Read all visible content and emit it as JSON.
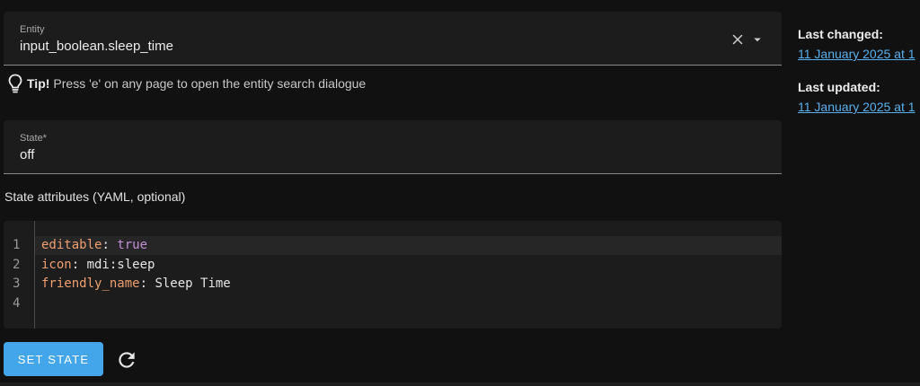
{
  "entity_field": {
    "label": "Entity",
    "value": "input_boolean.sleep_time"
  },
  "tip": {
    "title": "Tip!",
    "text": "Press 'e' on any page to open the entity search dialogue"
  },
  "state_field": {
    "label": "State*",
    "value": "off"
  },
  "attributes": {
    "label": "State attributes (YAML, optional)",
    "line_numbers": [
      "1",
      "2",
      "3",
      "4"
    ],
    "lines": [
      {
        "key": "editable",
        "value": "true"
      },
      {
        "key": "icon",
        "value": "mdi:sleep"
      },
      {
        "key": "friendly_name",
        "value": "Sleep Time"
      }
    ]
  },
  "actions": {
    "set_state_label": "SET STATE"
  },
  "sidebar": {
    "last_changed_label": "Last changed:",
    "last_changed_value": "11 January 2025 at 1",
    "last_updated_label": "Last updated:",
    "last_updated_value": "11 January 2025 at 1"
  },
  "icons": {
    "clear": "close-icon",
    "dropdown": "menu-down-icon",
    "tip": "lightbulb-outline-icon",
    "refresh": "refresh-icon"
  },
  "colors": {
    "primary": "#43a6ea",
    "link": "#5ab0ee",
    "yaml_key": "#f0a070",
    "yaml_bool": "#c58fd6"
  }
}
